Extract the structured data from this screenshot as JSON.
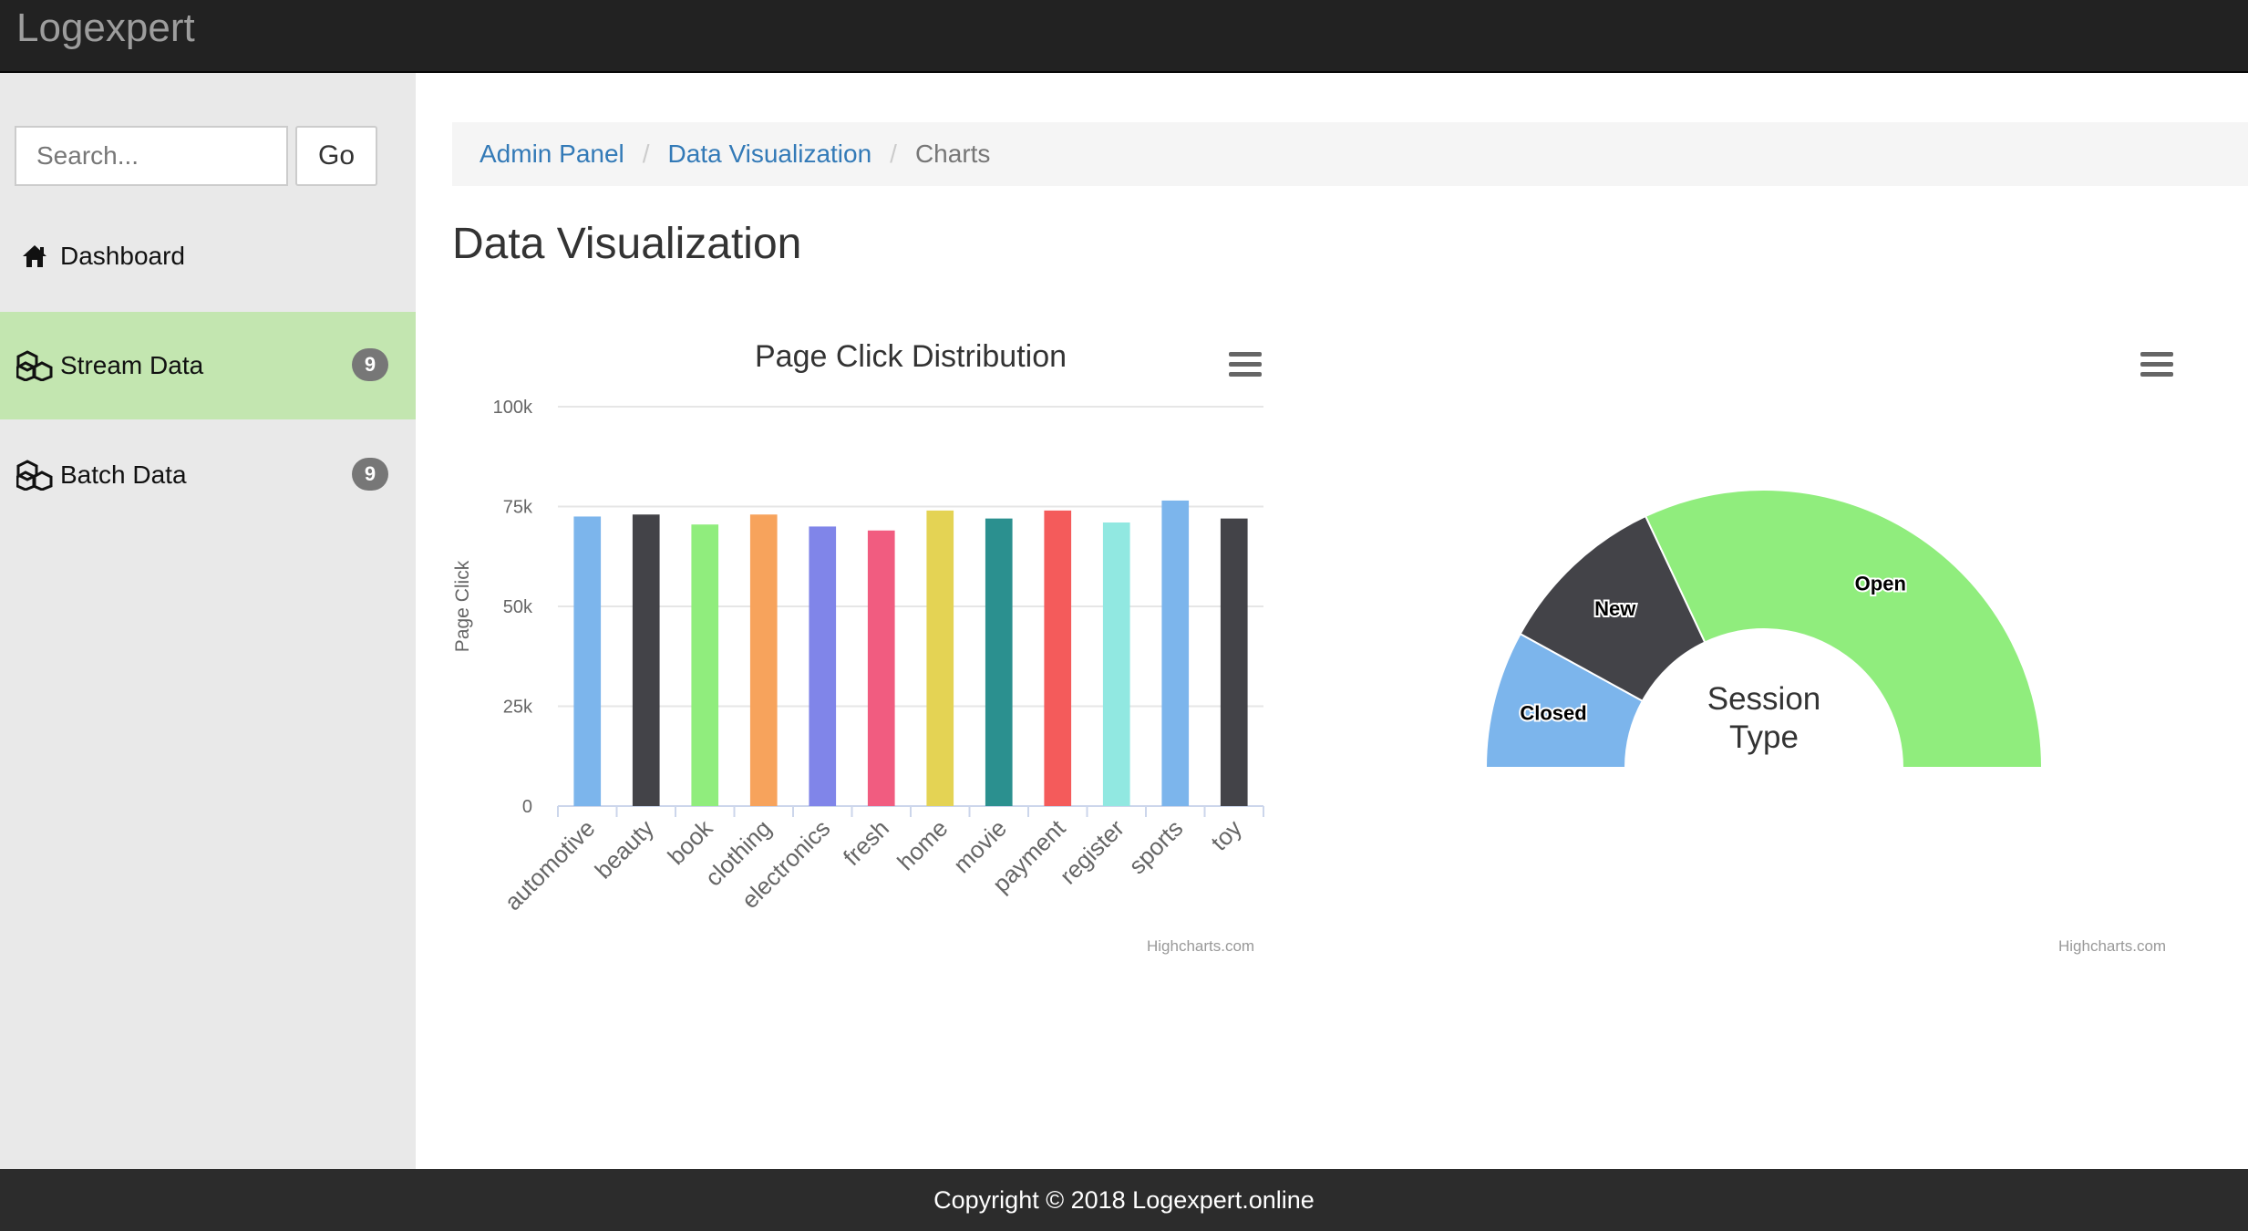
{
  "app": {
    "title": "Logexpert"
  },
  "sidebar": {
    "search": {
      "placeholder": "Search...",
      "value": ""
    },
    "go_label": "Go",
    "items": [
      {
        "label": "Dashboard",
        "icon": "home-icon",
        "active": false
      },
      {
        "label": "Stream Data",
        "icon": "cubes-icon",
        "active": true,
        "badge": "9"
      },
      {
        "label": "Batch Data",
        "icon": "cubes-icon",
        "active": false,
        "badge": "9"
      }
    ]
  },
  "breadcrumb": {
    "items": [
      "Admin Panel",
      "Data Visualization",
      "Charts"
    ]
  },
  "page": {
    "title": "Data Visualization"
  },
  "colors": {
    "topbar": "#222222",
    "active_nav": "#c3e6b0",
    "link": "#337ab7",
    "footer": "#2c2c2c"
  },
  "chart_data": [
    {
      "type": "bar",
      "title": "Page Click Distribution",
      "ylabel": "Page Click",
      "ylim": [
        0,
        100000
      ],
      "yticks": [
        "0",
        "25k",
        "50k",
        "75k",
        "100k"
      ],
      "ytick_values": [
        0,
        25000,
        50000,
        75000,
        100000
      ],
      "grid": true,
      "categories": [
        "automotive",
        "beauty",
        "book",
        "clothing",
        "electronics",
        "fresh",
        "home",
        "movie",
        "payment",
        "register",
        "sports",
        "toy"
      ],
      "values": [
        72500,
        73000,
        70500,
        73000,
        70000,
        69000,
        74000,
        72000,
        74000,
        71000,
        76500,
        72000
      ],
      "colors": [
        "#7cb5ec",
        "#434348",
        "#90ed7d",
        "#f7a35c",
        "#8085e9",
        "#f15c80",
        "#e4d354",
        "#2b908f",
        "#f45b5b",
        "#91e8e1",
        "#7cb5ec",
        "#434348"
      ],
      "credits": "Highcharts.com"
    },
    {
      "type": "pie",
      "subtype": "semi-donut",
      "title": "Session Type",
      "labels": [
        "Closed",
        "New",
        "Open"
      ],
      "values": [
        16,
        20,
        64
      ],
      "colors": [
        "#7cb5ec",
        "#434348",
        "#90ed7d"
      ],
      "credits": "Highcharts.com"
    }
  ],
  "footer": {
    "text": "Copyright © 2018 Logexpert.online"
  }
}
